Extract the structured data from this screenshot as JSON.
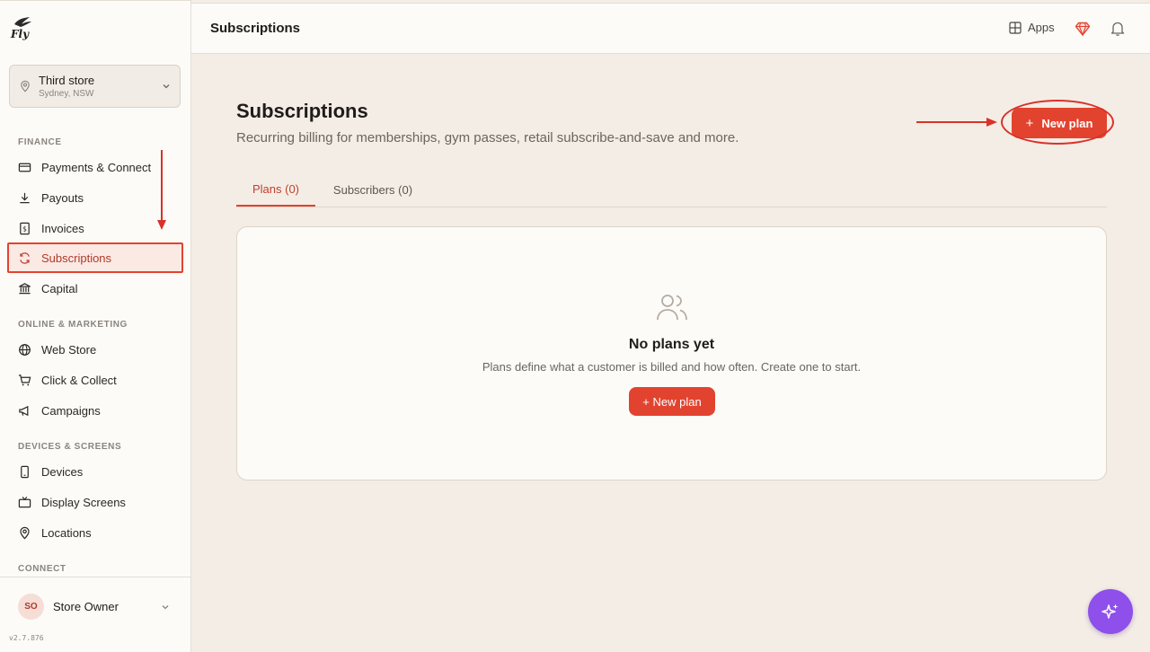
{
  "app": {
    "logo_text": "Fly"
  },
  "store": {
    "name": "Third store",
    "location": "Sydney, NSW"
  },
  "sidebar": {
    "sections": [
      {
        "label": "FINANCE"
      },
      {
        "label": "ONLINE & MARKETING"
      },
      {
        "label": "DEVICES & SCREENS"
      },
      {
        "label": "CONNECT"
      }
    ],
    "items": [
      {
        "label": "Payments & Connect",
        "icon": "card-icon"
      },
      {
        "label": "Payouts",
        "icon": "download-icon"
      },
      {
        "label": "Invoices",
        "icon": "invoice-icon"
      },
      {
        "label": "Subscriptions",
        "icon": "refresh-icon",
        "active": true
      },
      {
        "label": "Capital",
        "icon": "bank-icon"
      },
      {
        "label": "Web Store",
        "icon": "globe-icon"
      },
      {
        "label": "Click & Collect",
        "icon": "cart-icon"
      },
      {
        "label": "Campaigns",
        "icon": "megaphone-icon"
      },
      {
        "label": "Devices",
        "icon": "device-icon"
      },
      {
        "label": "Display Screens",
        "icon": "tv-icon"
      },
      {
        "label": "Locations",
        "icon": "pin-icon"
      }
    ]
  },
  "user": {
    "initials": "SO",
    "name": "Store Owner",
    "version": "v2.7.876"
  },
  "topbar": {
    "title": "Subscriptions",
    "apps_label": "Apps"
  },
  "main": {
    "title": "Subscriptions",
    "subtitle": "Recurring billing for memberships, gym passes, retail subscribe-and-save and more.",
    "new_plan_label": "New plan",
    "new_plan_plus": "+",
    "tabs": [
      {
        "label": "Plans (0)",
        "active": true
      },
      {
        "label": "Subscribers (0)",
        "active": false
      }
    ],
    "empty": {
      "title": "No plans yet",
      "description": "Plans define what a customer is billed and how often. Create one to start.",
      "button_label": "+ New plan"
    }
  },
  "colors": {
    "accent": "#e2432f",
    "annotation": "#d9322a",
    "fab": "#8e4fea",
    "background": "#f4ede6"
  }
}
